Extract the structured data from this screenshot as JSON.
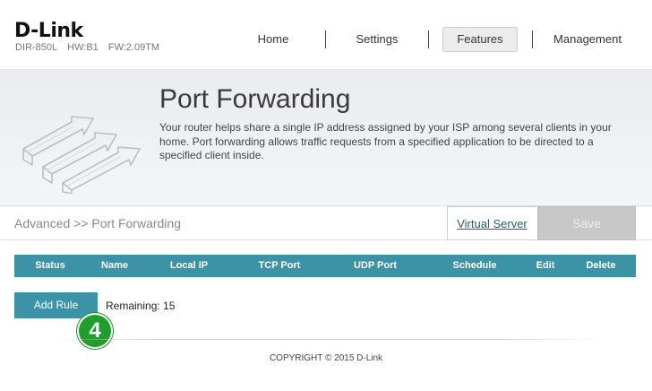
{
  "header": {
    "logo": "D-Link",
    "model": "DIR-850L",
    "hw": "HW:B1",
    "fw": "FW:2.09TM",
    "nav": [
      "Home",
      "Settings",
      "Features",
      "Management"
    ],
    "active_nav": "Features"
  },
  "banner": {
    "title": "Port Forwarding",
    "description": "Your router helps share a single IP address assigned by your ISP among several clients in your home. Port forwarding allows traffic requests from a specified application to be directed to a specified client inside.",
    "icon": "port-forwarding-arrows-icon"
  },
  "toolbar": {
    "breadcrumb": "Advanced >> Port Forwarding",
    "virtual_server_link": "Virtual Server",
    "save_label": "Save"
  },
  "table": {
    "columns": [
      "Status",
      "Name",
      "Local IP",
      "TCP Port",
      "UDP Port",
      "Schedule",
      "Edit",
      "Delete"
    ],
    "header_color": "#3d93a6"
  },
  "rules": {
    "add_label": "Add Rule",
    "remaining": "Remaining: 15",
    "step_badge": "4"
  },
  "footer": {
    "copyright": "COPYRIGHT © 2015 D-Link"
  },
  "colors": {
    "accent": "#3d93a6",
    "badge": "#1e9e2a",
    "save_disabled": "#c8c8c8"
  }
}
